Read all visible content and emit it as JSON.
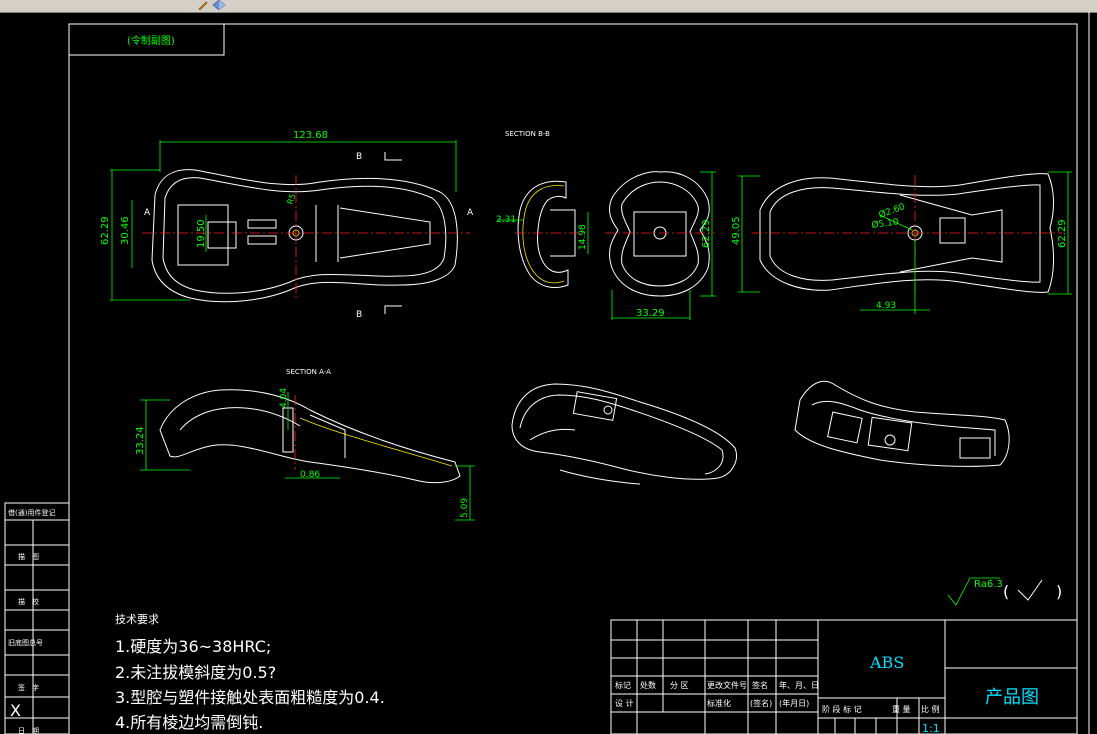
{
  "toolbar": {
    "icons": [
      "pencil-icon",
      "diamond-icon"
    ]
  },
  "drawing": {
    "corner_label": "(令制副图)",
    "section_bb_label": "SECTION B-B",
    "section_aa_label": "SECTION A-A",
    "marker_a": "A",
    "marker_b": "B",
    "dims": {
      "top_length": "123.68",
      "left_height": "62.29",
      "inner_height": "30.46",
      "inner_width": "19.50",
      "small_r": "R5",
      "section_b_wall": "2.31",
      "section_b_gap": "14.98",
      "front_height": "62.29",
      "front_width": "33.29",
      "right_height_left": "49.05",
      "right_height": "62.29",
      "right_bottom": "4.93",
      "hole_outer": "Ø2.60",
      "hole_inner": "Ø5.10",
      "side_height": "33.24",
      "side_top": "4.04",
      "side_bottom": "0.86",
      "side_thick": "5.09"
    },
    "roughness": {
      "symbol": "Ra6.3",
      "paren_open": "(",
      "paren_close": ")"
    }
  },
  "tech": {
    "title": "技术要求",
    "lines": [
      "1.硬度为36~38HRC;",
      "2.未注拔模斜度为0.5?",
      "3.型腔与塑件接触处表面粗糙度为0.4.",
      "4.所有棱边均需倒钝."
    ]
  },
  "left_strip": [
    "借(通)用件登记",
    "描　图",
    "描　校",
    "旧底图总号",
    "签　字",
    "X",
    "日　期"
  ],
  "title_block": {
    "material": "ABS",
    "product": "产品图",
    "row_labels": [
      "标记",
      "处数",
      "分 区",
      "更改文件号",
      "签名",
      "年、月、日"
    ],
    "row2": [
      "设 计",
      "标准化",
      "(签名)",
      "(年月日)"
    ],
    "stage_labels": [
      "阶 段 标 记",
      "重 量",
      "比 例"
    ],
    "scale": "1:1"
  }
}
